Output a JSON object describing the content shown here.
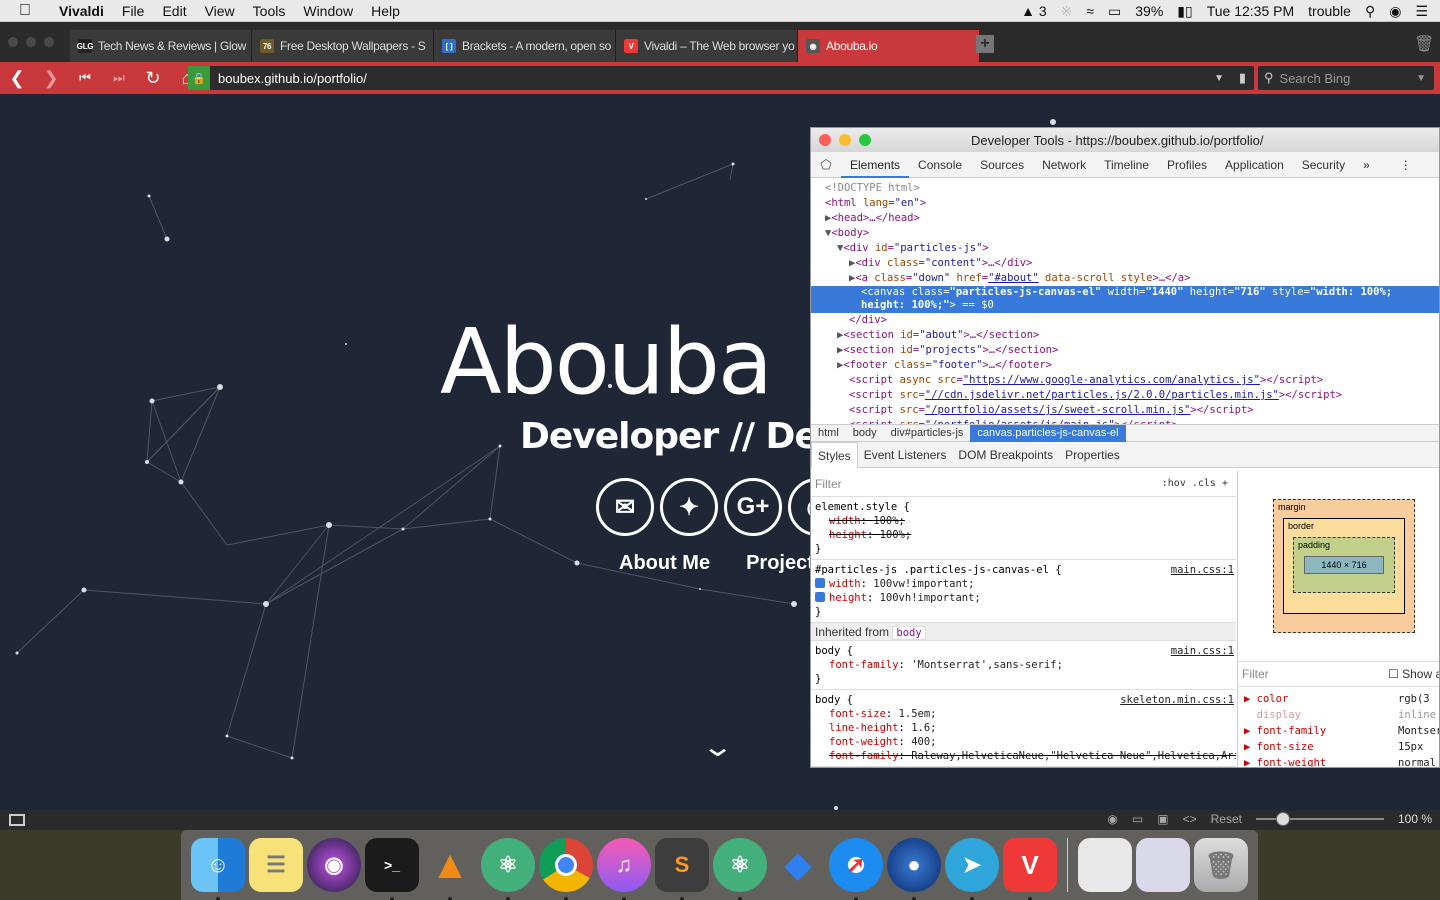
{
  "menubar": {
    "app": "Vivaldi",
    "items": [
      "File",
      "Edit",
      "View",
      "Tools",
      "Window",
      "Help"
    ],
    "status": {
      "adobe_count": "3",
      "battery": "39%",
      "clock": "Tue 12:35 PM",
      "user": "trouble"
    }
  },
  "tabs": [
    {
      "title": "Tech News & Reviews | Glow",
      "fav": "GLG",
      "color": "#222"
    },
    {
      "title": "Free Desktop Wallpapers - S",
      "fav": "76",
      "color": "#6b5b2b"
    },
    {
      "title": "Brackets - A modern, open so",
      "fav": "[ ]",
      "color": "#2f6fc9"
    },
    {
      "title": "Vivaldi – The Web browser yo",
      "fav": "V",
      "color": "#ef3939"
    },
    {
      "title": "Abouba.io",
      "fav": "◉",
      "color": "#555",
      "active": true
    }
  ],
  "address": {
    "url": "boubex.github.io/portfolio/",
    "search_placeholder": "Search Bing"
  },
  "hero": {
    "title": "Abouba",
    "subtitle": "Developer // Des",
    "nav": [
      "About Me",
      "Project"
    ]
  },
  "devtools": {
    "title": "Developer Tools - https://boubex.github.io/portfolio/",
    "tabs": [
      "Elements",
      "Console",
      "Sources",
      "Network",
      "Timeline",
      "Profiles",
      "Application",
      "Security",
      "»"
    ],
    "breadcrumbs": [
      "html",
      "body",
      "div#particles-js",
      "canvas.particles-js-canvas-el"
    ],
    "styles_tabs": [
      "Styles",
      "Event Listeners",
      "DOM Breakpoints",
      "Properties"
    ],
    "filter": "Filter",
    "hov_cls": ":hov  .cls   +",
    "inherited": "Inherited from",
    "inherited_el": "body",
    "box": {
      "margin": "margin",
      "border": "border",
      "padding": "padding",
      "content": "1440 × 716",
      "dash": "-"
    },
    "computed_filter": "Filter",
    "show_all": "Show al",
    "computed": [
      {
        "name": "color",
        "value": "rgb(3"
      },
      {
        "name": "display",
        "value": "inline"
      },
      {
        "name": "font-family",
        "value": "Montser"
      },
      {
        "name": "font-size",
        "value": "15px"
      },
      {
        "name": "font-weight",
        "value": "normal"
      }
    ]
  },
  "statusbar": {
    "reset": "Reset",
    "zoom": "100 %"
  }
}
